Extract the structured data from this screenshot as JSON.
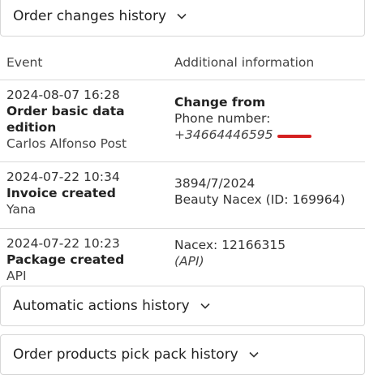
{
  "sections": {
    "order_changes": {
      "title": "Order changes history"
    },
    "automatic_actions": {
      "title": "Automatic actions history"
    },
    "pick_pack": {
      "title": "Order products pick pack history"
    }
  },
  "table": {
    "headers": {
      "event": "Event",
      "info": "Additional information"
    },
    "rows": [
      {
        "date": "2024-08-07 16:28",
        "event": "Order basic data edition",
        "author": "Carlos Alfonso Post",
        "info_title": "Change from",
        "info_line1": "Phone number:",
        "info_line2": "+34664446595"
      },
      {
        "date": "2024-07-22 10:34",
        "event": "Invoice created",
        "author": "Yana",
        "info_line1": "3894/7/2024",
        "info_line2": "Beauty Nacex (ID: 169964)"
      },
      {
        "date": "2024-07-22 10:23",
        "event": "Package created",
        "author": "API",
        "info_line1": "Nacex: 12166315",
        "info_line2": "(API)"
      }
    ]
  },
  "colors": {
    "redaction": "#d42020",
    "border": "#d7d7d7"
  }
}
